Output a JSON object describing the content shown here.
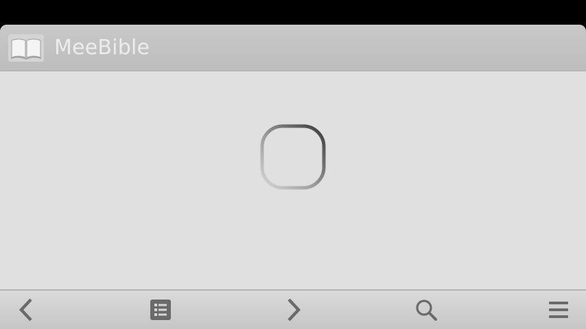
{
  "app": {
    "title": "MeeBible",
    "icon": "open-book-icon"
  },
  "content": {
    "state": "loading",
    "spinner_icon": "busy-spinner-icon"
  },
  "toolbar": {
    "buttons": [
      {
        "name": "back-button",
        "icon": "chevron-left-icon"
      },
      {
        "name": "chapters-button",
        "icon": "list-icon"
      },
      {
        "name": "forward-button",
        "icon": "chevron-right-icon"
      },
      {
        "name": "search-button",
        "icon": "search-icon"
      },
      {
        "name": "menu-button",
        "icon": "menu-icon"
      }
    ]
  },
  "colors": {
    "header_bg": "#c2c2c2",
    "content_bg": "#e0e0e0",
    "title_text": "#ececec",
    "toolbar_icon": "#6a6a6a"
  }
}
